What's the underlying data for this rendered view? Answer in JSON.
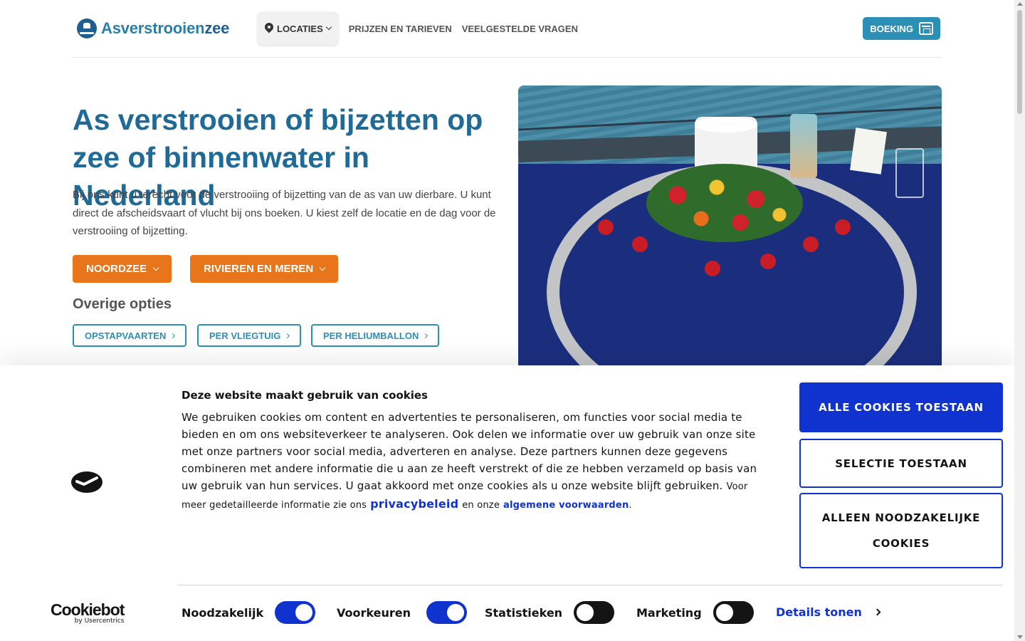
{
  "header": {
    "logo_text_main": "Asverstrooien",
    "logo_text_accent": "zee",
    "nav": [
      {
        "label": "LOCATIES",
        "icon": "map-pin-icon",
        "has_dropdown": true,
        "active": true
      },
      {
        "label": "PRIJZEN EN TARIEVEN"
      },
      {
        "label": "VEELGESTELDE VRAGEN"
      }
    ],
    "booking_label": "BOEKING",
    "booking_icon": "calendar-icon"
  },
  "hero": {
    "title": "As verstrooien of bijzetten op zee of binnenwater in Nederland",
    "text": "Bij ons kunt u terecht voor de verstrooiing of bijzetting van de as van uw dierbare. U kunt direct de afscheidsvaart of vlucht bij ons boeken. U kiest zelf de locatie en de dag voor de verstrooiing of bijzetting.",
    "primary_buttons": [
      "NOORDZEE",
      "RIVIEREN EN MEREN"
    ],
    "other_title": "Overige opties",
    "other_buttons": [
      "OPSTAPVAARTEN",
      "PER VLIEGTUIG",
      "PER HELIUMBALLON"
    ]
  },
  "cookie_banner": {
    "title": "Deze website maakt gebruik van cookies",
    "text": "We gebruiken cookies om content en advertenties te personaliseren, om functies voor social media te bieden en om ons websiteverkeer te analyseren. Ook delen we informatie over uw gebruik van onze site met onze partners voor social media, adverteren en analyse. Deze partners kunnen deze gegevens combineren met andere informatie die u aan ze heeft verstrekt of die ze hebben verzameld op basis van uw gebruik van hun services. U gaat akkoord met onze cookies als u onze website blijft gebruiken.",
    "more_info_prefix": "Voor meer gedetailleerde informatie zie ons",
    "privacy_link": "privacybeleid",
    "more_info_middle": "en onze",
    "terms_link": "algemene voorwaarden",
    "more_info_suffix": ".",
    "buttons": {
      "allow_all": "ALLE COOKIES TOESTAAN",
      "allow_selection": "SELECTIE TOESTAAN",
      "necessary_only": "ALLEEN NOODZAKELIJKE COOKIES"
    },
    "toggles": [
      {
        "label": "Noodzakelijk",
        "on": true
      },
      {
        "label": "Voorkeuren",
        "on": true
      },
      {
        "label": "Statistieken",
        "on": false
      },
      {
        "label": "Marketing",
        "on": false
      }
    ],
    "details_label": "Details tonen",
    "brand": "Cookiebot",
    "brand_sub": "by Usercentrics"
  },
  "colors": {
    "teal": "#2c8fb5",
    "title_blue": "#1f6a96",
    "orange": "#e8751a",
    "cookie_blue": "#1032cf"
  }
}
